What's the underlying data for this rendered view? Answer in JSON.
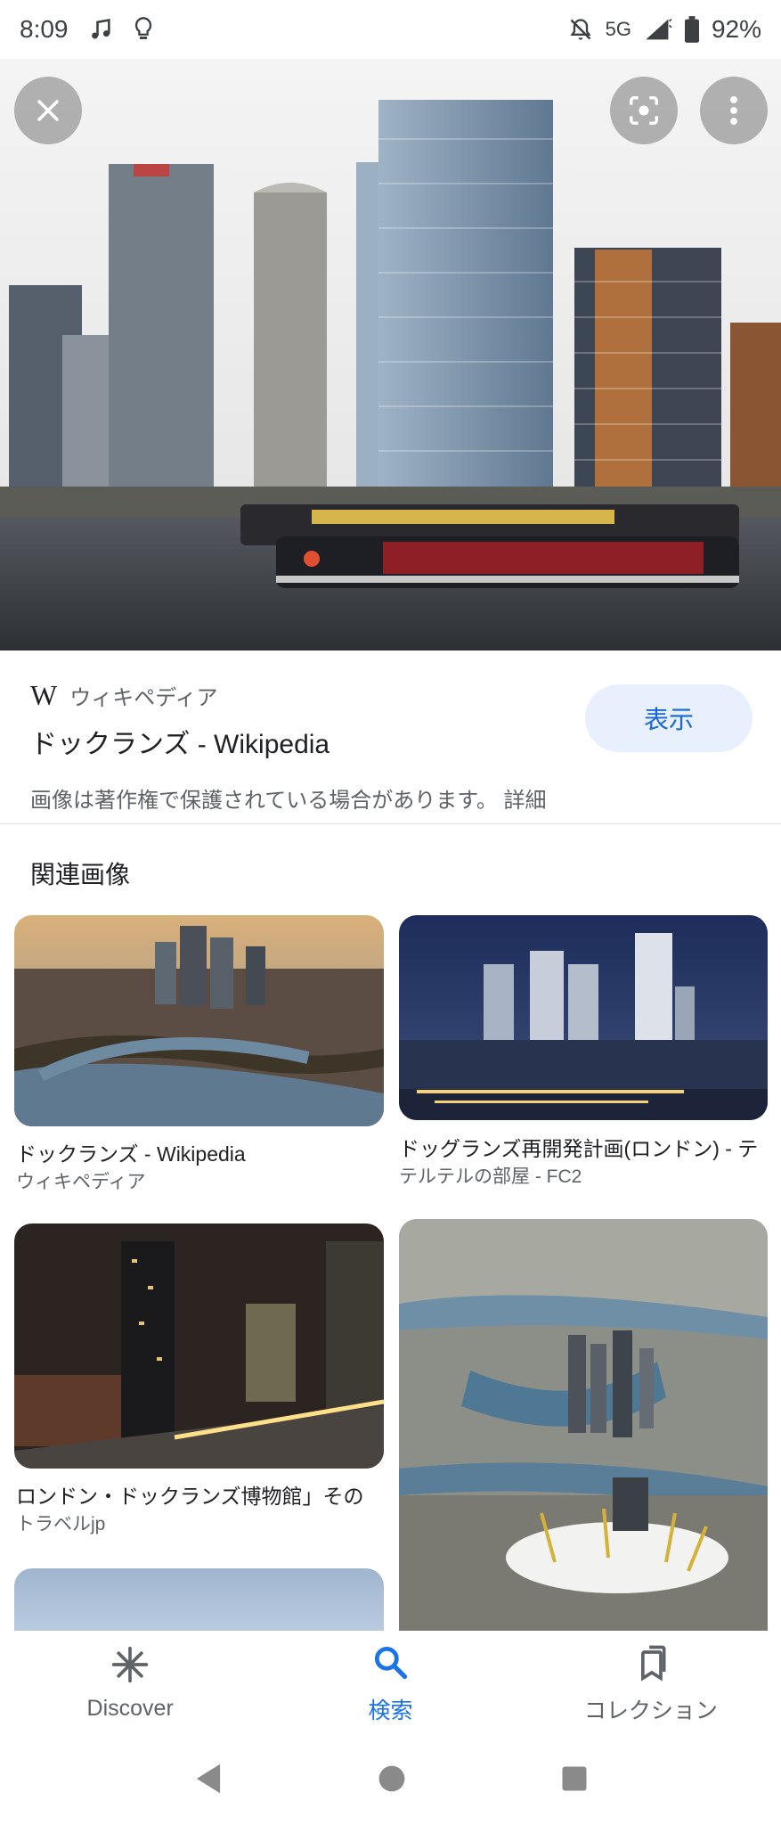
{
  "status_bar": {
    "time": "8:09",
    "network": "5G",
    "battery": "92%"
  },
  "source": {
    "site_logo": "W",
    "site_name": "ウィキペディア",
    "title": "ドックランズ - Wikipedia",
    "view_button": "表示",
    "copyright_notice": "画像は著作権で保護されている場合があります。 詳細"
  },
  "related": {
    "heading": "関連画像",
    "items": [
      {
        "title": "ドックランズ - Wikipedia",
        "source": "ウィキペディア"
      },
      {
        "title": "ドッグランズ再開発計画(ロンドン) - テ",
        "source": "テルテルの部屋 - FC2"
      },
      {
        "title": "ロンドン・ドックランズ博物館」その",
        "source": "トラベルjp"
      }
    ]
  },
  "bottom_nav": {
    "items": [
      {
        "label": "Discover",
        "icon": "asterisk-icon"
      },
      {
        "label": "検索",
        "icon": "search-icon",
        "active": true
      },
      {
        "label": "コレクション",
        "icon": "bookmarks-icon"
      }
    ]
  },
  "colors": {
    "accent": "#1a73e8",
    "view_button_bg": "#e8f0fe"
  }
}
